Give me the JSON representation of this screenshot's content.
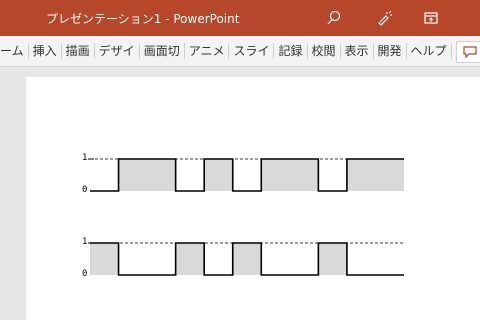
{
  "app": {
    "title": "プレゼンテーション1  -  PowerPoint",
    "accent": "#b7472a",
    "icons": [
      "search-icon",
      "pen-icon",
      "window-restore-icon",
      "comment-icon"
    ]
  },
  "ribbon": {
    "tabs": [
      "ーム",
      "挿入",
      "描画",
      "デザイ",
      "画面切",
      "アニメ",
      "スライ",
      "記録",
      "校閲",
      "表示",
      "開発",
      "ヘルプ"
    ]
  },
  "slide": {
    "waveforms": [
      {
        "high_label": "1",
        "low_label": "0",
        "levels": [
          0,
          1,
          1,
          0,
          1,
          0,
          1,
          1,
          0,
          1,
          1
        ]
      },
      {
        "high_label": "1",
        "low_label": "0",
        "levels": [
          1,
          0,
          0,
          1,
          0,
          1,
          0,
          0,
          1,
          0,
          0
        ]
      }
    ],
    "fill_color": "#d9d9d9"
  }
}
